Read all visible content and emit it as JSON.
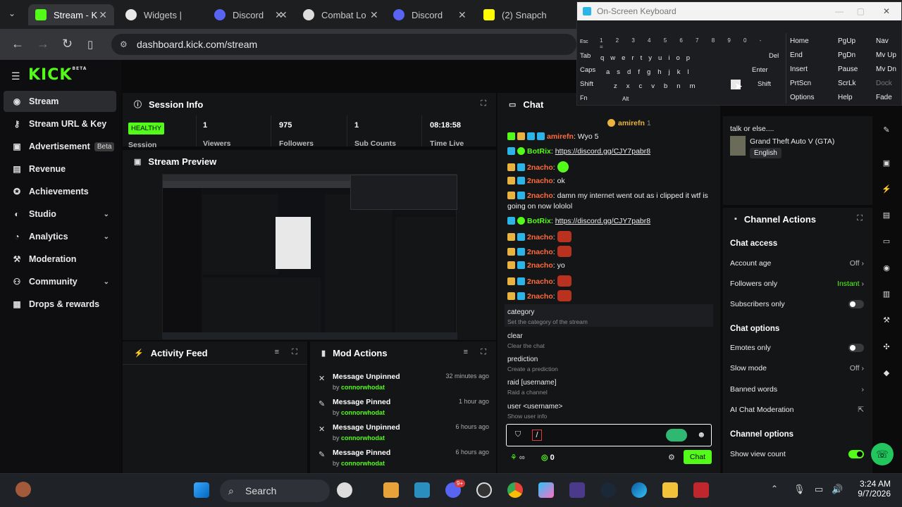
{
  "browser": {
    "tabs": [
      {
        "title": "Stream - K",
        "active": true,
        "color": "#53fc18"
      },
      {
        "title": "Widgets |",
        "active": false,
        "color": "#444"
      },
      {
        "title": "Discord",
        "active": false,
        "color": "#5865f2"
      },
      {
        "title": "Combat Lo",
        "active": false,
        "color": "#555"
      },
      {
        "title": "Discord",
        "active": false,
        "color": "#5865f2"
      },
      {
        "title": "(2) Snapch",
        "active": false,
        "color": "#fffc00"
      }
    ],
    "url": "dashboard.kick.com/stream"
  },
  "sidebar": {
    "logo": "KICK",
    "logo_sup": "BETA",
    "items": [
      {
        "label": "Stream",
        "icon": "radio-icon"
      },
      {
        "label": "Stream URL & Key",
        "icon": "key-icon"
      },
      {
        "label": "Advertisement",
        "icon": "ad-icon",
        "badge": "Beta"
      },
      {
        "label": "Revenue",
        "icon": "money-icon"
      },
      {
        "label": "Achievements",
        "icon": "trophy-icon"
      },
      {
        "label": "Studio",
        "icon": "studio-icon"
      },
      {
        "label": "Analytics",
        "icon": "chart-icon"
      },
      {
        "label": "Moderation",
        "icon": "hammer-icon"
      },
      {
        "label": "Community",
        "icon": "people-icon"
      },
      {
        "label": "Drops & rewards",
        "icon": "gift-icon"
      }
    ]
  },
  "session": {
    "title": "Session Info",
    "health": "HEALTHY",
    "session_label": "Session",
    "viewers": "1",
    "viewers_label": "Viewers",
    "followers": "975",
    "followers_label": "Followers",
    "subs": "1",
    "subs_label": "Sub Counts",
    "time": "08:18:58",
    "time_label": "Time Live"
  },
  "preview": {
    "title": "Stream Preview"
  },
  "activity": {
    "title": "Activity Feed"
  },
  "mod_actions": {
    "title": "Mod Actions",
    "items": [
      {
        "action": "Message Unpinned",
        "by": "by",
        "user": "connorwhodat",
        "time": "32 minutes ago"
      },
      {
        "action": "Message Pinned",
        "by": "by",
        "user": "connorwhodat",
        "time": "1 hour ago"
      },
      {
        "action": "Message Unpinned",
        "by": "by",
        "user": "connorwhodat",
        "time": "6 hours ago"
      },
      {
        "action": "Message Pinned",
        "by": "by",
        "user": "connorwhodat",
        "time": "6 hours ago"
      }
    ]
  },
  "chat": {
    "title": "Chat",
    "pinned_user": "amirefn",
    "pinned_count": "1",
    "messages": [
      {
        "user": "amirefn",
        "text": "Wyo 5"
      },
      {
        "user": "BotRix",
        "link": "https://discord.gg/CJY7pabr8"
      },
      {
        "user": "2nacho",
        "text": ""
      },
      {
        "user": "2nacho",
        "text": "ok"
      },
      {
        "user": "2nacho",
        "text": "damn my internet went out as i clipped it wtf is going on now lololol"
      },
      {
        "user": "BotRix",
        "link": "https://discord.gg/CJY7pabr8"
      },
      {
        "user": "2nacho",
        "text": ""
      },
      {
        "user": "2nacho",
        "text": ""
      },
      {
        "user": "2nacho",
        "text": "yo"
      },
      {
        "user": "2nacho",
        "text": ""
      },
      {
        "user": "2nacho",
        "text": ""
      }
    ],
    "commands": [
      {
        "name": "category",
        "desc": "Set the category of the stream"
      },
      {
        "name": "clear",
        "desc": "Clear the chat"
      },
      {
        "name": "prediction",
        "desc": "Create a prediction"
      },
      {
        "name": "raid [username]",
        "desc": "Raid a channel"
      },
      {
        "name": "user <username>",
        "desc": "Show user info"
      }
    ],
    "input_value": "/",
    "footer_count": "0",
    "send_label": "Chat"
  },
  "stream_info": {
    "title_text": "talk or else....",
    "category": "Grand Theft Auto V (GTA)",
    "language": "English"
  },
  "channel_actions": {
    "title": "Channel Actions",
    "chat_access": "Chat access",
    "account_age": "Account age",
    "account_age_val": "Off",
    "followers_only": "Followers only",
    "followers_only_val": "Instant",
    "subscribers_only": "Subscribers only",
    "chat_options": "Chat options",
    "emotes_only": "Emotes only",
    "slow_mode": "Slow mode",
    "slow_mode_val": "Off",
    "banned_words": "Banned words",
    "ai_moderation": "AI Chat Moderation",
    "channel_options": "Channel options",
    "show_view_count": "Show view count"
  },
  "keyboard": {
    "title": "On-Screen Keyboard",
    "right_keys": [
      [
        "Home",
        "PgUp",
        "Nav"
      ],
      [
        "End",
        "PgDn",
        "Mv Up"
      ],
      [
        "Insert",
        "Pause",
        "Mv Dn"
      ],
      [
        "PrtScn",
        "ScrLk",
        "Dock"
      ],
      [
        "Options",
        "Help",
        "Fade"
      ]
    ],
    "row_labels": [
      "Esc",
      "Tab",
      "Caps",
      "Shift",
      "Fn"
    ],
    "row2": [
      "q",
      "w",
      "e",
      "r",
      "t",
      "y",
      "u",
      "i",
      "o",
      "p"
    ],
    "row3": [
      "a",
      "s",
      "d",
      "f",
      "g",
      "h",
      "j",
      "k",
      "l"
    ],
    "row4": [
      "z",
      "x",
      "c",
      "v",
      "b",
      "n",
      "m"
    ],
    "enter": "Enter",
    "del": "Del",
    "shift_r": "Shift",
    "alt": "Alt"
  },
  "taskbar": {
    "search": "Search",
    "time": "3:24 AM",
    "date": "9/7/2026",
    "discord_badge": "9+"
  },
  "colors": {
    "accent": "#53fc18",
    "bg": "#0b0b0c",
    "panel": "#141517"
  }
}
